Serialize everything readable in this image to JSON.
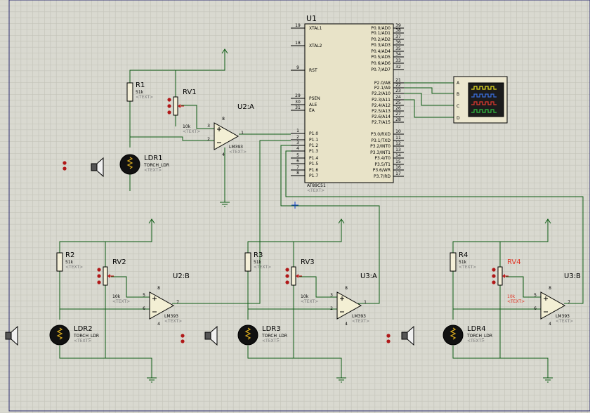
{
  "colors": {
    "background": "#d9d9d0",
    "grid": "#c4c4b9",
    "wire": "#0b5a12",
    "mcu_fill": "#e8e3c8",
    "opamp_fill": "#f3efd4",
    "label_grey": "#7a7a7a",
    "highlight_red": "#e03020",
    "scope_fill": "#ece7cf"
  },
  "mcu": {
    "ref": "U1",
    "part": "AT89C51",
    "text_placeholder": "<TEXT>",
    "left_pins": [
      {
        "num": "19",
        "name": "XTAL1"
      },
      {
        "num": "18",
        "name": "XTAL2"
      },
      {
        "num": "9",
        "name": "RST"
      },
      {
        "num": "29",
        "name": "PSEN"
      },
      {
        "num": "30",
        "name": "ALE"
      },
      {
        "num": "31",
        "name": "EA"
      },
      {
        "num": "1",
        "name": "P1.0"
      },
      {
        "num": "2",
        "name": "P1.1"
      },
      {
        "num": "3",
        "name": "P1.2"
      },
      {
        "num": "4",
        "name": "P1.3"
      },
      {
        "num": "5",
        "name": "P1.4"
      },
      {
        "num": "6",
        "name": "P1.5"
      },
      {
        "num": "7",
        "name": "P1.6"
      },
      {
        "num": "8",
        "name": "P1.7"
      }
    ],
    "right_pins": [
      {
        "num": "39",
        "name": "P0.0/AD0"
      },
      {
        "num": "38",
        "name": "P0.1/AD1"
      },
      {
        "num": "37",
        "name": "P0.2/AD2"
      },
      {
        "num": "36",
        "name": "P0.3/AD3"
      },
      {
        "num": "35",
        "name": "P0.4/AD4"
      },
      {
        "num": "34",
        "name": "P0.5/AD5"
      },
      {
        "num": "33",
        "name": "P0.6/AD6"
      },
      {
        "num": "32",
        "name": "P0.7/AD7"
      },
      {
        "num": "21",
        "name": "P2.0/A8"
      },
      {
        "num": "22",
        "name": "P2.1/A9"
      },
      {
        "num": "23",
        "name": "P2.2/A10"
      },
      {
        "num": "24",
        "name": "P2.3/A11"
      },
      {
        "num": "25",
        "name": "P2.4/A12"
      },
      {
        "num": "26",
        "name": "P2.5/A13"
      },
      {
        "num": "27",
        "name": "P2.6/A14"
      },
      {
        "num": "28",
        "name": "P2.7/A15"
      },
      {
        "num": "10",
        "name": "P3.0/RXD"
      },
      {
        "num": "11",
        "name": "P3.1/TXD"
      },
      {
        "num": "12",
        "name": "P3.2/INT0"
      },
      {
        "num": "13",
        "name": "P3.3/INT1"
      },
      {
        "num": "14",
        "name": "P3.4/T0"
      },
      {
        "num": "15",
        "name": "P3.5/T1"
      },
      {
        "num": "16",
        "name": "P3.6/WR"
      },
      {
        "num": "17",
        "name": "P3.7/RD"
      }
    ]
  },
  "oscilloscope": {
    "channels": [
      "A",
      "B",
      "C",
      "D"
    ],
    "trace_colors": [
      "#e8e020",
      "#3a70e0",
      "#e03a30",
      "#30c040"
    ]
  },
  "stages": [
    {
      "resistor": {
        "ref": "R1",
        "value": "51k",
        "text": "<TEXT>"
      },
      "pot": {
        "ref": "RV1",
        "value": "10k",
        "text": "<TEXT>",
        "highlight": false
      },
      "ldr": {
        "ref": "LDR1",
        "part": "TORCH_LDR",
        "text": "<TEXT>"
      },
      "opamp": {
        "ref": "U2:A",
        "part": "LM393",
        "text": "<TEXT>",
        "pin_plus": "3",
        "pin_minus": "2",
        "pin_out": "1",
        "pin_vcc": "8",
        "pin_gnd": "4"
      }
    },
    {
      "resistor": {
        "ref": "R2",
        "value": "51k",
        "text": "<TEXT>"
      },
      "pot": {
        "ref": "RV2",
        "value": "10k",
        "text": "<TEXT>",
        "highlight": false
      },
      "ldr": {
        "ref": "LDR2",
        "part": "TORCH_LDR",
        "text": "<TEXT>"
      },
      "opamp": {
        "ref": "U2:B",
        "part": "LM393",
        "text": "<TEXT>",
        "pin_plus": "5",
        "pin_minus": "6",
        "pin_out": "7",
        "pin_vcc": "8",
        "pin_gnd": "4"
      }
    },
    {
      "resistor": {
        "ref": "R3",
        "value": "51k",
        "text": "<TEXT>"
      },
      "pot": {
        "ref": "RV3",
        "value": "10k",
        "text": "<TEXT>",
        "highlight": false
      },
      "ldr": {
        "ref": "LDR3",
        "part": "TORCH_LDR",
        "text": "<TEXT>"
      },
      "opamp": {
        "ref": "U3:A",
        "part": "LM393",
        "text": "<TEXT>",
        "pin_plus": "3",
        "pin_minus": "2",
        "pin_out": "1",
        "pin_vcc": "8",
        "pin_gnd": "4"
      }
    },
    {
      "resistor": {
        "ref": "R4",
        "value": "51k",
        "text": "<TEXT>"
      },
      "pot": {
        "ref": "RV4",
        "value": "10k",
        "text": "<TEXT>",
        "highlight": true
      },
      "ldr": {
        "ref": "LDR4",
        "part": "TORCH_LDR",
        "text": "<TEXT>"
      },
      "opamp": {
        "ref": "U3:B",
        "part": "LM393",
        "text": "<TEXT>",
        "pin_plus": "5",
        "pin_minus": "6",
        "pin_out": "7",
        "pin_vcc": "8",
        "pin_gnd": "4"
      }
    }
  ]
}
